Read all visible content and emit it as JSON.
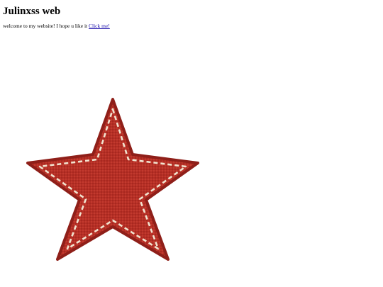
{
  "page": {
    "title": "Julinxss web",
    "intro_text": "welcome to my website! I hope u like it ",
    "link_label": "Click me!"
  },
  "star": {
    "icon": "star-icon",
    "fill_color": "#b52f26",
    "edge_color": "#8f1f19",
    "stitch_color": "#f1e3cf"
  }
}
